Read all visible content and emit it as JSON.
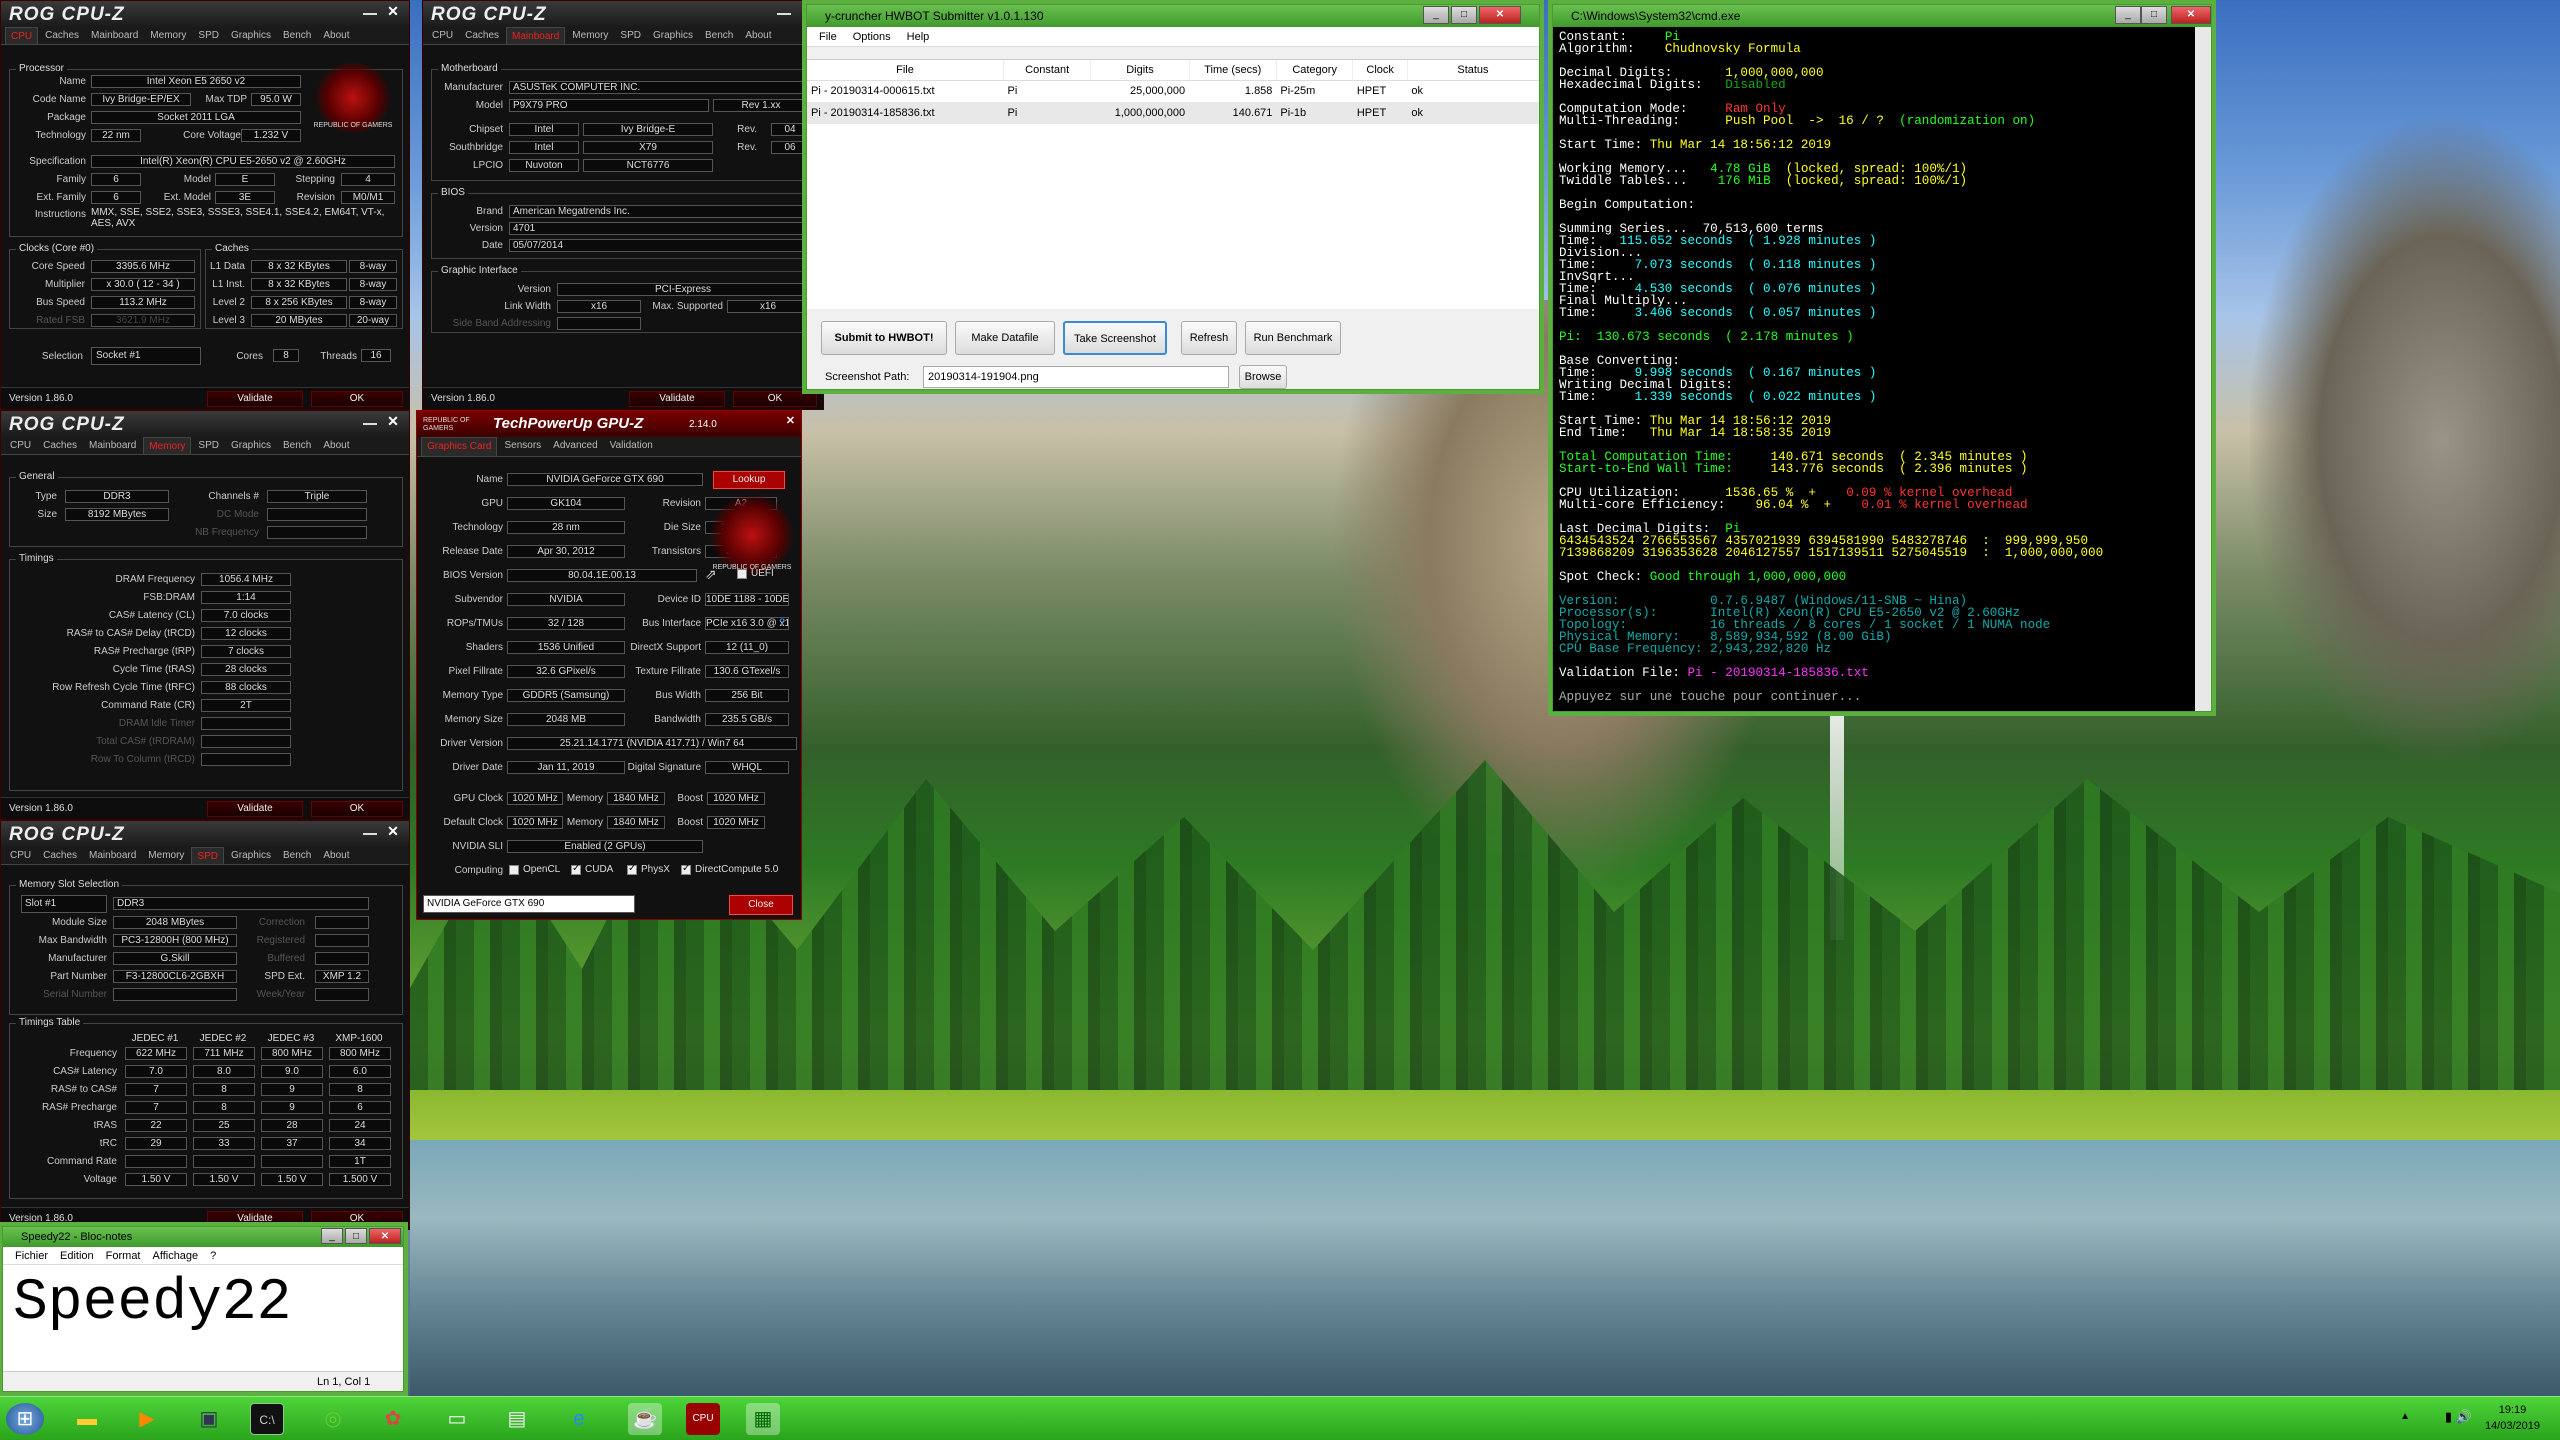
{
  "cpuz_cpu": {
    "logo": "ROG CPU-Z",
    "tabs": [
      "CPU",
      "Caches",
      "Mainboard",
      "Memory",
      "SPD",
      "Graphics",
      "Bench",
      "About"
    ],
    "processor_title": "Processor",
    "name_lbl": "Name",
    "name": "Intel Xeon E5 2650 v2",
    "codename_lbl": "Code Name",
    "codename": "Ivy Bridge-EP/EX",
    "maxtdp_lbl": "Max TDP",
    "maxtdp": "95.0 W",
    "package_lbl": "Package",
    "package": "Socket 2011 LGA",
    "tech_lbl": "Technology",
    "tech": "22 nm",
    "cv_lbl": "Core Voltage",
    "cv": "1.232 V",
    "spec_lbl": "Specification",
    "spec": "Intel(R) Xeon(R) CPU E5-2650 v2 @ 2.60GHz",
    "family_lbl": "Family",
    "family": "6",
    "model_lbl": "Model",
    "model": "E",
    "stepping_lbl": "Stepping",
    "stepping": "4",
    "extfam_lbl": "Ext. Family",
    "extfam": "6",
    "extmod_lbl": "Ext. Model",
    "extmod": "3E",
    "rev_lbl": "Revision",
    "rev": "M0/M1",
    "instr_lbl": "Instructions",
    "instr": "MMX, SSE, SSE2, SSE3, SSSE3, SSE4.1, SSE4.2, EM64T, VT-x, AES, AVX",
    "clocks_title": "Clocks (Core #0)",
    "cs_lbl": "Core Speed",
    "cs": "3395.6 MHz",
    "mult_lbl": "Multiplier",
    "mult": "x 30.0 ( 12 - 34 )",
    "bus_lbl": "Bus Speed",
    "bus": "113.2 MHz",
    "fsb_lbl": "Rated FSB",
    "fsb": "3621.9 MHz",
    "caches_title": "Caches",
    "l1d_lbl": "L1 Data",
    "l1d": "8 x 32 KBytes",
    "l1d_w": "8-way",
    "l1i_lbl": "L1 Inst.",
    "l1i": "8 x 32 KBytes",
    "l1i_w": "8-way",
    "l2_lbl": "Level 2",
    "l2": "8 x 256 KBytes",
    "l2_w": "8-way",
    "l3_lbl": "Level 3",
    "l3": "20 MBytes",
    "l3_w": "20-way",
    "sel_lbl": "Selection",
    "sel": "Socket #1",
    "cores_lbl": "Cores",
    "cores": "8",
    "threads_lbl": "Threads",
    "threads": "16",
    "version": "Version 1.86.0",
    "validate": "Validate",
    "ok": "OK",
    "rog_text": "REPUBLIC OF GAMERS"
  },
  "cpuz_mb": {
    "logo": "ROG CPU-Z",
    "tabs": [
      "CPU",
      "Caches",
      "Mainboard",
      "Memory",
      "SPD",
      "Graphics",
      "Bench",
      "About"
    ],
    "mb_title": "Motherboard",
    "manu_lbl": "Manufacturer",
    "manu": "ASUSTeK COMPUTER INC.",
    "model_lbl": "Model",
    "model": "P9X79 PRO",
    "model_rev": "Rev 1.xx",
    "chipset_lbl": "Chipset",
    "chipset_v": "Intel",
    "chipset": "Ivy Bridge-E",
    "chipset_rev_lbl": "Rev.",
    "chipset_rev": "04",
    "sb_lbl": "Southbridge",
    "sb_v": "Intel",
    "sb": "X79",
    "sb_rev_lbl": "Rev.",
    "sb_rev": "06",
    "lpcio_lbl": "LPCIO",
    "lpcio_v": "Nuvoton",
    "lpcio": "NCT6776",
    "bios_title": "BIOS",
    "brand_lbl": "Brand",
    "brand": "American Megatrends Inc.",
    "bver_lbl": "Version",
    "bver": "4701",
    "date_lbl": "Date",
    "date": "05/07/2014",
    "gi_title": "Graphic Interface",
    "giv_lbl": "Version",
    "giv": "PCI-Express",
    "lw_lbl": "Link Width",
    "lw": "x16",
    "ms_lbl": "Max. Supported",
    "ms": "x16",
    "sba_lbl": "Side Band Addressing",
    "version": "Version 1.86.0",
    "validate": "Validate",
    "ok": "OK"
  },
  "cpuz_mem": {
    "logo": "ROG CPU-Z",
    "tabs": [
      "CPU",
      "Caches",
      "Mainboard",
      "Memory",
      "SPD",
      "Graphics",
      "Bench",
      "About"
    ],
    "gen_title": "General",
    "type_lbl": "Type",
    "type": "DDR3",
    "ch_lbl": "Channels #",
    "ch": "Triple",
    "size_lbl": "Size",
    "size": "8192 MBytes",
    "dc_lbl": "DC Mode",
    "nb_lbl": "NB Frequency",
    "tim_title": "Timings",
    "rows": [
      {
        "l": "DRAM Frequency",
        "v": "1056.4 MHz",
        "dim": false
      },
      {
        "l": "FSB:DRAM",
        "v": "1:14",
        "dim": false
      },
      {
        "l": "CAS# Latency (CL)",
        "v": "7.0 clocks",
        "dim": false
      },
      {
        "l": "RAS# to CAS# Delay (tRCD)",
        "v": "12 clocks",
        "dim": false
      },
      {
        "l": "RAS# Precharge (tRP)",
        "v": "7 clocks",
        "dim": false
      },
      {
        "l": "Cycle Time (tRAS)",
        "v": "28 clocks",
        "dim": false
      },
      {
        "l": "Row Refresh Cycle Time (tRFC)",
        "v": "88 clocks",
        "dim": false
      },
      {
        "l": "Command Rate (CR)",
        "v": "2T",
        "dim": false
      },
      {
        "l": "DRAM Idle Timer",
        "v": "",
        "dim": true
      },
      {
        "l": "Total CAS# (tRDRAM)",
        "v": "",
        "dim": true
      },
      {
        "l": "Row To Column (tRCD)",
        "v": "",
        "dim": true
      }
    ],
    "version": "Version 1.86.0",
    "validate": "Validate",
    "ok": "OK"
  },
  "cpuz_spd": {
    "logo": "ROG CPU-Z",
    "tabs": [
      "CPU",
      "Caches",
      "Mainboard",
      "Memory",
      "SPD",
      "Graphics",
      "Bench",
      "About"
    ],
    "slot_title": "Memory Slot Selection",
    "slot": "Slot #1",
    "slot_type": "DDR3",
    "ms_lbl": "Module Size",
    "ms": "2048 MBytes",
    "corr_lbl": "Correction",
    "mb_lbl": "Max Bandwidth",
    "mb": "PC3-12800H (800 MHz)",
    "reg_lbl": "Registered",
    "manu_lbl": "Manufacturer",
    "manu": "G.Skill",
    "buf_lbl": "Buffered",
    "pn_lbl": "Part Number",
    "pn": "F3-12800CL6-2GBXH",
    "spd_lbl": "SPD Ext.",
    "spd": "XMP 1.2",
    "sn_lbl": "Serial Number",
    "wy_lbl": "Week/Year",
    "tt_title": "Timings Table",
    "cols": [
      "JEDEC #1",
      "JEDEC #2",
      "JEDEC #3",
      "XMP-1600"
    ],
    "trows": [
      {
        "l": "Frequency",
        "v": [
          "622 MHz",
          "711 MHz",
          "800 MHz",
          "800 MHz"
        ]
      },
      {
        "l": "CAS# Latency",
        "v": [
          "7.0",
          "8.0",
          "9.0",
          "6.0"
        ]
      },
      {
        "l": "RAS# to CAS#",
        "v": [
          "7",
          "8",
          "9",
          "8"
        ]
      },
      {
        "l": "RAS# Precharge",
        "v": [
          "7",
          "8",
          "9",
          "6"
        ]
      },
      {
        "l": "tRAS",
        "v": [
          "22",
          "25",
          "28",
          "24"
        ]
      },
      {
        "l": "tRC",
        "v": [
          "29",
          "33",
          "37",
          "34"
        ]
      },
      {
        "l": "Command Rate",
        "v": [
          "",
          "",
          "",
          "1T"
        ]
      },
      {
        "l": "Voltage",
        "v": [
          "1.50 V",
          "1.50 V",
          "1.50 V",
          "1.500 V"
        ]
      }
    ],
    "version": "Version 1.86.0",
    "validate": "Validate",
    "ok": "OK"
  },
  "gpuz": {
    "rog": "REPUBLIC OF GAMERS",
    "title": "TechPowerUp GPU-Z",
    "ver": "2.14.0",
    "tabs": [
      "Graphics Card",
      "Sensors",
      "Advanced",
      "Validation"
    ],
    "rows": [
      {
        "l": "Name",
        "v": "NVIDIA GeForce GTX 690"
      },
      {
        "l": "GPU",
        "v": "GK104",
        "l2": "Revision",
        "v2": "A2"
      },
      {
        "l": "Technology",
        "v": "28 nm",
        "l2": "Die Size",
        "v2": "294 mm²"
      },
      {
        "l": "Release Date",
        "v": "Apr 30, 2012",
        "l2": "Transistors",
        "v2": "3540M"
      },
      {
        "l": "BIOS Version",
        "v": "80.04.1E.00.13"
      },
      {
        "l": "Subvendor",
        "v": "NVIDIA",
        "l2": "Device ID",
        "v2": "10DE 1188 - 10DE 095B"
      },
      {
        "l": "ROPs/TMUs",
        "v": "32 / 128",
        "l2": "Bus Interface",
        "v2": "PCIe x16 3.0 @ x16 1.1"
      },
      {
        "l": "Shaders",
        "v": "1536 Unified",
        "l2": "DirectX Support",
        "v2": "12 (11_0)"
      },
      {
        "l": "Pixel Fillrate",
        "v": "32.6 GPixel/s",
        "l2": "Texture Fillrate",
        "v2": "130.6 GTexel/s"
      },
      {
        "l": "Memory Type",
        "v": "GDDR5 (Samsung)",
        "l2": "Bus Width",
        "v2": "256 Bit"
      },
      {
        "l": "Memory Size",
        "v": "2048 MB",
        "l2": "Bandwidth",
        "v2": "235.5 GB/s"
      },
      {
        "l": "Driver Version",
        "v": "25.21.14.1771 (NVIDIA 417.71) / Win7 64"
      },
      {
        "l": "Driver Date",
        "v": "Jan 11, 2019",
        "l2": "Digital Signature",
        "v2": "WHQL"
      }
    ],
    "lookup": "Lookup",
    "uefi": "UEFI",
    "gc_lbl": "GPU Clock",
    "gc": "1020 MHz",
    "mem_lbl": "Memory",
    "gcm": "1840 MHz",
    "boost_lbl": "Boost",
    "gcb": "1020 MHz",
    "dc_lbl": "Default Clock",
    "dc": "1020 MHz",
    "dcm": "1840 MHz",
    "dcb": "1020 MHz",
    "sli_lbl": "NVIDIA SLI",
    "sli": "Enabled (2 GPUs)",
    "comp_lbl": "Computing",
    "opencl": "OpenCL",
    "cuda": "CUDA",
    "physx": "PhysX",
    "dc5": "DirectCompute 5.0",
    "card": "NVIDIA GeForce GTX 690",
    "close": "Close"
  },
  "hwbot": {
    "title": "y-cruncher HWBOT Submitter v1.0.1.130",
    "menu": [
      "File",
      "Options",
      "Help"
    ],
    "cols": [
      "File",
      "Constant",
      "Digits",
      "Time (secs)",
      "Category",
      "Clock",
      "Status"
    ],
    "rows": [
      [
        "Pi - 20190314-000615.txt",
        "Pi",
        "25,000,000",
        "1.858",
        "Pi-25m",
        "HPET",
        "ok"
      ],
      [
        "Pi - 20190314-185836.txt",
        "Pi",
        "1,000,000,000",
        "140.671",
        "Pi-1b",
        "HPET",
        "ok"
      ]
    ],
    "btns": [
      "Submit to HWBOT!",
      "Make Datafile",
      "Take Screenshot",
      "Refresh",
      "Run Benchmark"
    ],
    "sp_lbl": "Screenshot Path:",
    "sp": "20190314-191904.png",
    "browse": "Browse"
  },
  "cmd": {
    "title": "C:\\Windows\\System32\\cmd.exe",
    "lines": [
      [
        [
          "c-w",
          "Constant:     "
        ],
        [
          "c-g",
          "Pi"
        ]
      ],
      [
        [
          "c-w",
          "Algorithm:    "
        ],
        [
          "c-y",
          "Chudnovsky Formula"
        ]
      ],
      [
        [
          "c-w",
          ""
        ]
      ],
      [
        [
          "c-w",
          "Decimal Digits:       "
        ],
        [
          "c-y",
          "1,000,000,000"
        ]
      ],
      [
        [
          "c-w",
          "Hexadecimal Digits:   "
        ],
        [
          "c-dg",
          "Disabled"
        ]
      ],
      [
        [
          "c-w",
          ""
        ]
      ],
      [
        [
          "c-w",
          "Computation Mode:     "
        ],
        [
          "c-r",
          "Ram Only"
        ]
      ],
      [
        [
          "c-w",
          "Multi-Threading:      "
        ],
        [
          "c-y",
          "Push Pool  ->  16 / ?  "
        ],
        [
          "c-g",
          "(randomization on)"
        ]
      ],
      [
        [
          "c-w",
          ""
        ]
      ],
      [
        [
          "c-w",
          "Start Time: "
        ],
        [
          "c-y",
          "Thu Mar 14 18:56:12 2019"
        ]
      ],
      [
        [
          "c-w",
          ""
        ]
      ],
      [
        [
          "c-w",
          "Working Memory...   "
        ],
        [
          "c-g",
          "4.78 GiB"
        ],
        [
          "c-y",
          "  (locked, spread: 100%/1)"
        ]
      ],
      [
        [
          "c-w",
          "Twiddle Tables...    "
        ],
        [
          "c-g",
          "176 MiB"
        ],
        [
          "c-y",
          "  (locked, spread: 100%/1)"
        ]
      ],
      [
        [
          "c-w",
          ""
        ]
      ],
      [
        [
          "c-w",
          "Begin Computation:"
        ]
      ],
      [
        [
          "c-w",
          ""
        ]
      ],
      [
        [
          "c-w",
          "Summing Series...  70,513,600 terms"
        ]
      ],
      [
        [
          "c-w",
          "Time:   "
        ],
        [
          "c-c",
          "115.652 seconds  ( 1.928 minutes )"
        ]
      ],
      [
        [
          "c-w",
          "Division..."
        ]
      ],
      [
        [
          "c-w",
          "Time:     "
        ],
        [
          "c-c",
          "7.073 seconds  ( 0.118 minutes )"
        ]
      ],
      [
        [
          "c-w",
          "InvSqrt..."
        ]
      ],
      [
        [
          "c-w",
          "Time:     "
        ],
        [
          "c-c",
          "4.530 seconds  ( 0.076 minutes )"
        ]
      ],
      [
        [
          "c-w",
          "Final Multiply..."
        ]
      ],
      [
        [
          "c-w",
          "Time:     "
        ],
        [
          "c-c",
          "3.406 seconds  ( 0.057 minutes )"
        ]
      ],
      [
        [
          "c-w",
          ""
        ]
      ],
      [
        [
          "c-g",
          "Pi:  130.673 seconds  ( 2.178 minutes )"
        ]
      ],
      [
        [
          "c-w",
          ""
        ]
      ],
      [
        [
          "c-w",
          "Base Converting:"
        ]
      ],
      [
        [
          "c-w",
          "Time:     "
        ],
        [
          "c-c",
          "9.998 seconds  ( 0.167 minutes )"
        ]
      ],
      [
        [
          "c-w",
          "Writing Decimal Digits:"
        ]
      ],
      [
        [
          "c-w",
          "Time:     "
        ],
        [
          "c-c",
          "1.339 seconds  ( 0.022 minutes )"
        ]
      ],
      [
        [
          "c-w",
          ""
        ]
      ],
      [
        [
          "c-w",
          "Start Time: "
        ],
        [
          "c-y",
          "Thu Mar 14 18:56:12 2019"
        ]
      ],
      [
        [
          "c-w",
          "End Time:   "
        ],
        [
          "c-y",
          "Thu Mar 14 18:58:35 2019"
        ]
      ],
      [
        [
          "c-w",
          ""
        ]
      ],
      [
        [
          "c-g",
          "Total Computation Time:     "
        ],
        [
          "c-y",
          "140.671 seconds  ( 2.345 minutes )"
        ]
      ],
      [
        [
          "c-g",
          "Start-to-End Wall Time:     "
        ],
        [
          "c-y",
          "143.776 seconds  ( 2.396 minutes )"
        ]
      ],
      [
        [
          "c-w",
          ""
        ]
      ],
      [
        [
          "c-w",
          "CPU Utilization:      "
        ],
        [
          "c-y",
          "1536.65 %  +    "
        ],
        [
          "c-r",
          "0.09 % kernel overhead"
        ]
      ],
      [
        [
          "c-w",
          "Multi-core Efficiency: "
        ],
        [
          "c-y",
          "   96.04 %  +    "
        ],
        [
          "c-r",
          "0.01 % kernel overhead"
        ]
      ],
      [
        [
          "c-w",
          ""
        ]
      ],
      [
        [
          "c-w",
          "Last Decimal Digits:  "
        ],
        [
          "c-g",
          "Pi"
        ]
      ],
      [
        [
          "c-y",
          "6434543524 2766553567 4357021939 6394581990 5483278746  :  999,999,950"
        ]
      ],
      [
        [
          "c-y",
          "7139868209 3196353628 2046127557 1517139511 5275045519  :  1,000,000,000"
        ]
      ],
      [
        [
          "c-w",
          ""
        ]
      ],
      [
        [
          "c-w",
          "Spot Check: "
        ],
        [
          "c-g",
          "Good through 1,000,000,000"
        ]
      ],
      [
        [
          "c-w",
          ""
        ]
      ],
      [
        [
          "c-dc",
          "Version:            0.7.6.9487 (Windows/11-SNB ~ Hina)"
        ]
      ],
      [
        [
          "c-dc",
          "Processor(s):       Intel(R) Xeon(R) CPU E5-2650 v2 @ 2.60GHz"
        ]
      ],
      [
        [
          "c-dc",
          "Topology:           16 threads / 8 cores / 1 socket / 1 NUMA node"
        ]
      ],
      [
        [
          "c-dc",
          "Physical Memory:    8,589,934,592 (8.00 GiB)"
        ]
      ],
      [
        [
          "c-dc",
          "CPU Base Frequency: 2,943,292,820 Hz"
        ]
      ],
      [
        [
          "c-w",
          ""
        ]
      ],
      [
        [
          "c-w",
          "Validation File: "
        ],
        [
          "c-m",
          "Pi - 20190314-185836.txt"
        ]
      ],
      [
        [
          "c-w",
          ""
        ]
      ],
      [
        [
          "c-gr",
          "Appuyez sur une touche pour continuer..."
        ]
      ]
    ]
  },
  "notepad": {
    "title": "Speedy22 - Bloc-notes",
    "menu": [
      "Fichier",
      "Edition",
      "Format",
      "Affichage",
      "?"
    ],
    "text": "Speedy22",
    "status": "Ln 1, Col 1"
  },
  "taskbar": {
    "time": "19:19",
    "date": "14/03/2019"
  }
}
